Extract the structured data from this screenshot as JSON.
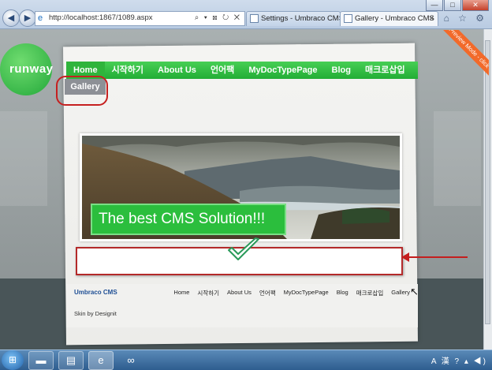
{
  "browser": {
    "window_controls": [
      "—",
      "□",
      "✕"
    ],
    "address": {
      "url": "http://localhost:1867/1089.aspx",
      "controls": "⌕ ▾ ⊠ ↻ ✕"
    },
    "tabs": [
      {
        "label": "Settings - Umbraco CMS - lo...",
        "active": false
      },
      {
        "label": "Gallery - Umbraco CMS",
        "active": true
      }
    ],
    "tools": "⌂ ☆ ⚙"
  },
  "site": {
    "logo_text": "runway",
    "nav": [
      "Home",
      "시작하기",
      "About Us",
      "언어팩",
      "MyDocTypePage",
      "Blog",
      "매크로삽입"
    ],
    "subnav": [
      "Gallery"
    ],
    "banner_text": "The best CMS Solution!!!",
    "preview_ribbon": "Preview Mode - click to end",
    "footer": {
      "brand": "Umbraco CMS",
      "nav": [
        "Home",
        "시작하기",
        "About Us",
        "언어팩",
        "MyDocTypePage",
        "Blog",
        "매크로삽입",
        "Gallery"
      ],
      "credit": "Skin by Designit"
    }
  },
  "taskbar": {
    "start_glyph": "⊞",
    "tray_text": "A 漢 ? ▴ ◀)"
  },
  "colors": {
    "accent": "#2bbe3d",
    "annotation": "#c41e1e",
    "ribbon": "#f26a2a"
  }
}
